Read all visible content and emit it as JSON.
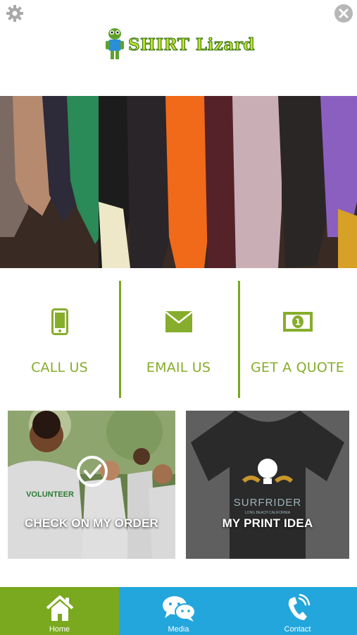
{
  "header": {
    "settings_icon": "gear-icon",
    "close_icon": "close-circle-icon",
    "logo_text": "SHIRT Lizard"
  },
  "hero": {
    "description_icon": "hanging-shirts-photo"
  },
  "actions": [
    {
      "label": "CALL US",
      "icon": "phone-icon"
    },
    {
      "label": "EMAIL US",
      "icon": "envelope-icon"
    },
    {
      "label": "GET A QUOTE",
      "icon": "money-bill-icon"
    }
  ],
  "tiles": {
    "order": {
      "label": "CHECK ON MY ORDER",
      "shirt_text": "VOLUNTEER"
    },
    "idea": {
      "label": "MY PRINT IDEA",
      "shirt_text": "SURFRIDER",
      "shirt_subtext": "LONG BEACH CALIFORNIA"
    }
  },
  "tabs": [
    {
      "label": "Home",
      "icon": "home-icon",
      "active": true
    },
    {
      "label": "Media",
      "icon": "chat-bubbles-icon",
      "active": false
    },
    {
      "label": "Contact",
      "icon": "phone-call-icon",
      "active": false
    }
  ],
  "colors": {
    "green": "#7aa81e",
    "blue": "#23a6dc",
    "label_green": "#86ad2c"
  }
}
